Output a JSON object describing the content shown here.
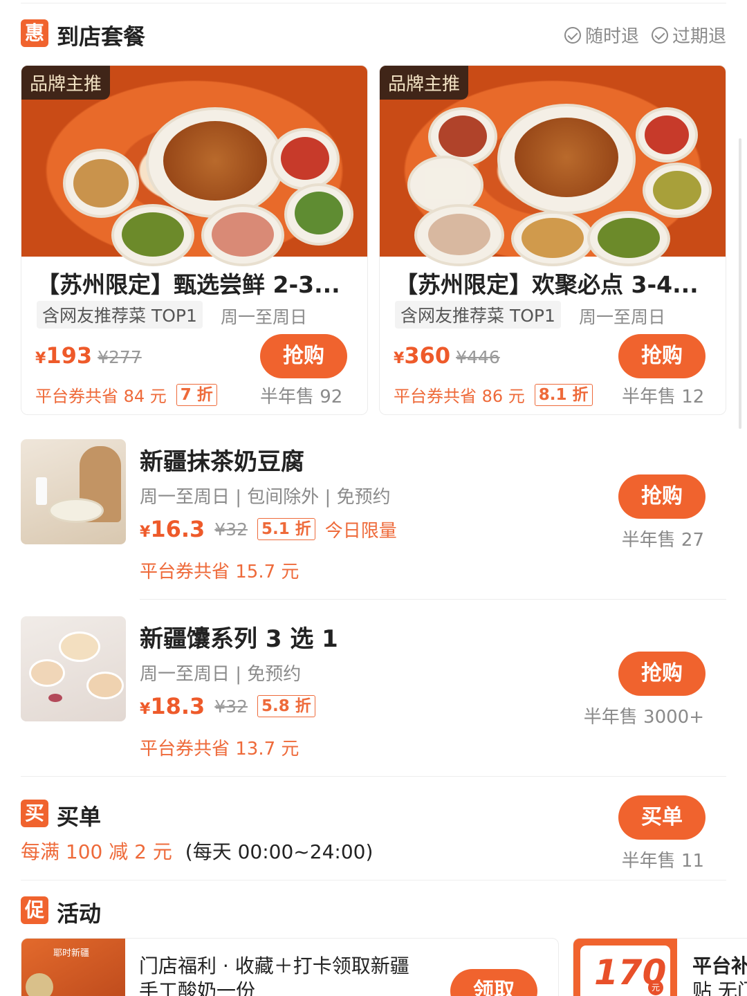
{
  "deal_section": {
    "badge": "惠",
    "title": "到店套餐",
    "policies": [
      "随时退",
      "过期退"
    ]
  },
  "packages": [
    {
      "brand_tag": "品牌主推",
      "title": "【苏州限定】甄选尝鲜 2-3...",
      "tag": "含网友推荐菜 TOP1",
      "days": "周一至周日",
      "price": "193",
      "currency": "¥",
      "original": "¥277",
      "save": "平台券共省 84 元",
      "discount": "7 折",
      "buy": "抢购",
      "sold": "半年售 92"
    },
    {
      "brand_tag": "品牌主推",
      "title": "【苏州限定】欢聚必点 3-4...",
      "tag": "含网友推荐菜 TOP1",
      "days": "周一至周日",
      "price": "360",
      "currency": "¥",
      "original": "¥446",
      "save": "平台券共省 86 元",
      "discount": "8.1 折",
      "buy": "抢购",
      "sold": "半年售 12"
    }
  ],
  "items": [
    {
      "title": "新疆抹茶奶豆腐",
      "sub": "周一至周日 | 包间除外 | 免预约",
      "currency": "¥",
      "price": "16.3",
      "original": "¥32",
      "discount": "5.1 折",
      "limit": "今日限量",
      "save": "平台券共省 15.7 元",
      "buy": "抢购",
      "sold": "半年售 27"
    },
    {
      "title": "新疆馕系列 3 选 1",
      "sub": "周一至周日 | 免预约",
      "currency": "¥",
      "price": "18.3",
      "original": "¥32",
      "discount": "5.8 折",
      "save": "平台券共省 13.7 元",
      "buy": "抢购",
      "sold": "半年售 3000+"
    }
  ],
  "bill": {
    "badge": "买",
    "title": "买单",
    "offer": "每满 100 减 2 元",
    "hours": "(每天 00:00~24:00)",
    "button": "买单",
    "sold": "半年售 11"
  },
  "activity": {
    "badge": "促",
    "title": "活动",
    "card1_title_line1": "门店福利 · 收藏＋打卡领取新疆",
    "card1_title_line2": "手工酸奶一份",
    "card1_button": "领取",
    "card1_thumb_text": "耶时新疆",
    "card2_amount": "170",
    "card2_unit": "元",
    "card2_title_line1": "平台补",
    "card2_title_line2": "贴 无门"
  },
  "colors": {
    "accent": "#f0632e",
    "price": "#ee5a2a"
  }
}
